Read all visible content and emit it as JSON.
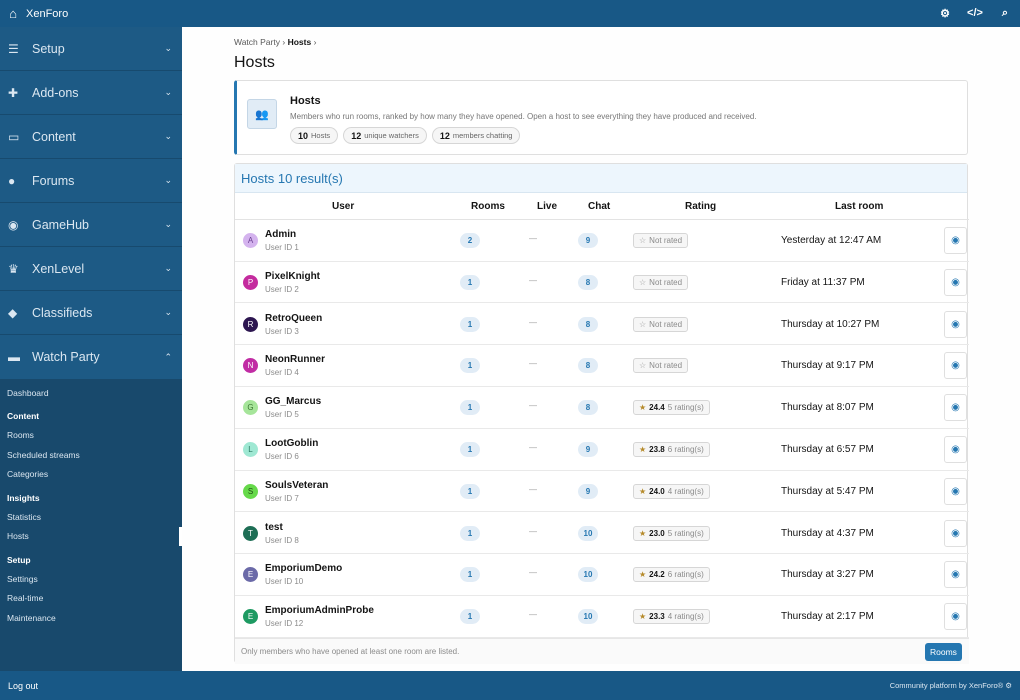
{
  "topbar": {
    "brand": "XenForo",
    "home_icon": "home-icon",
    "right_icons": [
      "gears-icon",
      "code-icon",
      "search-icon"
    ]
  },
  "sidebar": {
    "sections": [
      {
        "label": "Setup",
        "icon": "sliders-icon"
      },
      {
        "label": "Add-ons",
        "icon": "puzzle-icon"
      },
      {
        "label": "Content",
        "icon": "content-icon"
      },
      {
        "label": "Forums",
        "icon": "comments-icon"
      },
      {
        "label": "GameHub",
        "icon": "gamepad-icon"
      },
      {
        "label": "XenLevel",
        "icon": "trophy-icon"
      },
      {
        "label": "Classifieds",
        "icon": "tag-icon"
      },
      {
        "label": "Watch Party",
        "icon": "monitor-icon"
      }
    ],
    "sub": {
      "dashboard": "Dashboard",
      "content_header": "Content",
      "rooms": "Rooms",
      "scheduled": "Scheduled streams",
      "categories": "Categories",
      "insights_header": "Insights",
      "statistics": "Statistics",
      "hosts": "Hosts",
      "setup_header": "Setup",
      "settings": "Settings",
      "realtime": "Real-time",
      "maintenance": "Maintenance"
    }
  },
  "breadcrumb": {
    "items": [
      "Watch Party",
      "Hosts"
    ],
    "separator": "›"
  },
  "page_title": "Hosts",
  "info": {
    "title": "Hosts",
    "description": "Members who run rooms, ranked by how many they have opened. Open a host to see everything they have produced and received.",
    "pills": [
      {
        "count": "10",
        "label": "Hosts"
      },
      {
        "count": "12",
        "label": "unique watchers"
      },
      {
        "count": "12",
        "label": "members chatting"
      }
    ]
  },
  "table": {
    "heading": "Hosts 10 result(s)",
    "columns": [
      "User",
      "Rooms",
      "Live",
      "Chat",
      "Rating",
      "Last room"
    ],
    "rows": [
      {
        "initial": "A",
        "color": "#d4b3ee",
        "tcolor": "#6b3f92",
        "name": "Admin",
        "uid": "User ID 1",
        "rooms": "2",
        "live": "—",
        "chat": "9",
        "rating": "",
        "rating_label": "Not rated",
        "last": "Yesterday at 12:47 AM"
      },
      {
        "initial": "P",
        "color": "#c42b9e",
        "tcolor": "#ffffff",
        "name": "PixelKnight",
        "uid": "User ID 2",
        "rooms": "1",
        "live": "—",
        "chat": "8",
        "rating": "",
        "rating_label": "Not rated",
        "last": "Friday at 11:37 PM"
      },
      {
        "initial": "R",
        "color": "#2d1650",
        "tcolor": "#ffffff",
        "name": "RetroQueen",
        "uid": "User ID 3",
        "rooms": "1",
        "live": "—",
        "chat": "8",
        "rating": "",
        "rating_label": "Not rated",
        "last": "Thursday at 10:27 PM"
      },
      {
        "initial": "N",
        "color": "#c12ca4",
        "tcolor": "#ffffff",
        "name": "NeonRunner",
        "uid": "User ID 4",
        "rooms": "1",
        "live": "—",
        "chat": "8",
        "rating": "",
        "rating_label": "Not rated",
        "last": "Thursday at 9:17 PM"
      },
      {
        "initial": "G",
        "color": "#a6e59a",
        "tcolor": "#3d7a33",
        "name": "GG_Marcus",
        "uid": "User ID 5",
        "rooms": "1",
        "live": "—",
        "chat": "8",
        "rating": "24.4",
        "rating_label": "5 rating(s)",
        "last": "Thursday at 8:07 PM"
      },
      {
        "initial": "L",
        "color": "#9fe8d3",
        "tcolor": "#2c7a64",
        "name": "LootGoblin",
        "uid": "User ID 6",
        "rooms": "1",
        "live": "—",
        "chat": "9",
        "rating": "23.8",
        "rating_label": "6 rating(s)",
        "last": "Thursday at 6:57 PM"
      },
      {
        "initial": "S",
        "color": "#66d94a",
        "tcolor": "#1f4d14",
        "name": "SoulsVeteran",
        "uid": "User ID 7",
        "rooms": "1",
        "live": "—",
        "chat": "9",
        "rating": "24.0",
        "rating_label": "4 rating(s)",
        "last": "Thursday at 5:47 PM"
      },
      {
        "initial": "T",
        "color": "#1e6e55",
        "tcolor": "#ffffff",
        "name": "test",
        "uid": "User ID 8",
        "rooms": "1",
        "live": "—",
        "chat": "10",
        "rating": "23.0",
        "rating_label": "5 rating(s)",
        "last": "Thursday at 4:37 PM"
      },
      {
        "initial": "E",
        "color": "#6b6aa8",
        "tcolor": "#ffffff",
        "name": "EmporiumDemo",
        "uid": "User ID 10",
        "rooms": "1",
        "live": "—",
        "chat": "10",
        "rating": "24.2",
        "rating_label": "6 rating(s)",
        "last": "Thursday at 3:27 PM"
      },
      {
        "initial": "E",
        "color": "#1e9a62",
        "tcolor": "#ffffff",
        "name": "EmporiumAdminProbe",
        "uid": "User ID 12",
        "rooms": "1",
        "live": "—",
        "chat": "10",
        "rating": "23.3",
        "rating_label": "4 rating(s)",
        "last": "Thursday at 2:17 PM"
      }
    ],
    "footer_note": "Only members who have opened at least one room are listed.",
    "rooms_button": "Rooms"
  },
  "footer": {
    "logout": "Log out",
    "credit": "Community platform by XenForo®"
  }
}
